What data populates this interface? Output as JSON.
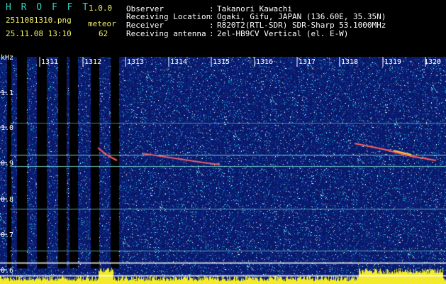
{
  "app": {
    "title": "H R O F F T",
    "version": "1.0.0"
  },
  "file": {
    "name": "2511081310.png",
    "date": "25.11.08 13:10"
  },
  "counter": {
    "label": "meteor",
    "value": "62"
  },
  "info": [
    {
      "key": "Observer",
      "sep": ":",
      "value": "Takanori Kawachi"
    },
    {
      "key": "Receiving Location",
      "sep": ":",
      "value": "Ogaki, Gifu, JAPAN (136.60E, 35.35N)"
    },
    {
      "key": "Receiver",
      "sep": ":",
      "value": "R820T2(RTL-SDR) SDR-Sharp 53.1000MHz"
    },
    {
      "key": "Receiving antenna",
      "sep": ":",
      "value": "2el-HB9CV Vertical (el. E-W)"
    }
  ],
  "axes": {
    "y_unit": "kHz",
    "y_ticks": [
      "1.1",
      "1.0",
      "0.9",
      "0.8",
      "0.7",
      "0.6"
    ],
    "x_ticks": [
      "1311",
      "1312",
      "1313",
      "1314",
      "1315",
      "1316",
      "1317",
      "1318",
      "1319",
      "1320"
    ]
  },
  "colors": {
    "header_teal": "#2fd3c4",
    "header_yellow": "#f1ef6a",
    "background": "#0a1a6e"
  }
}
